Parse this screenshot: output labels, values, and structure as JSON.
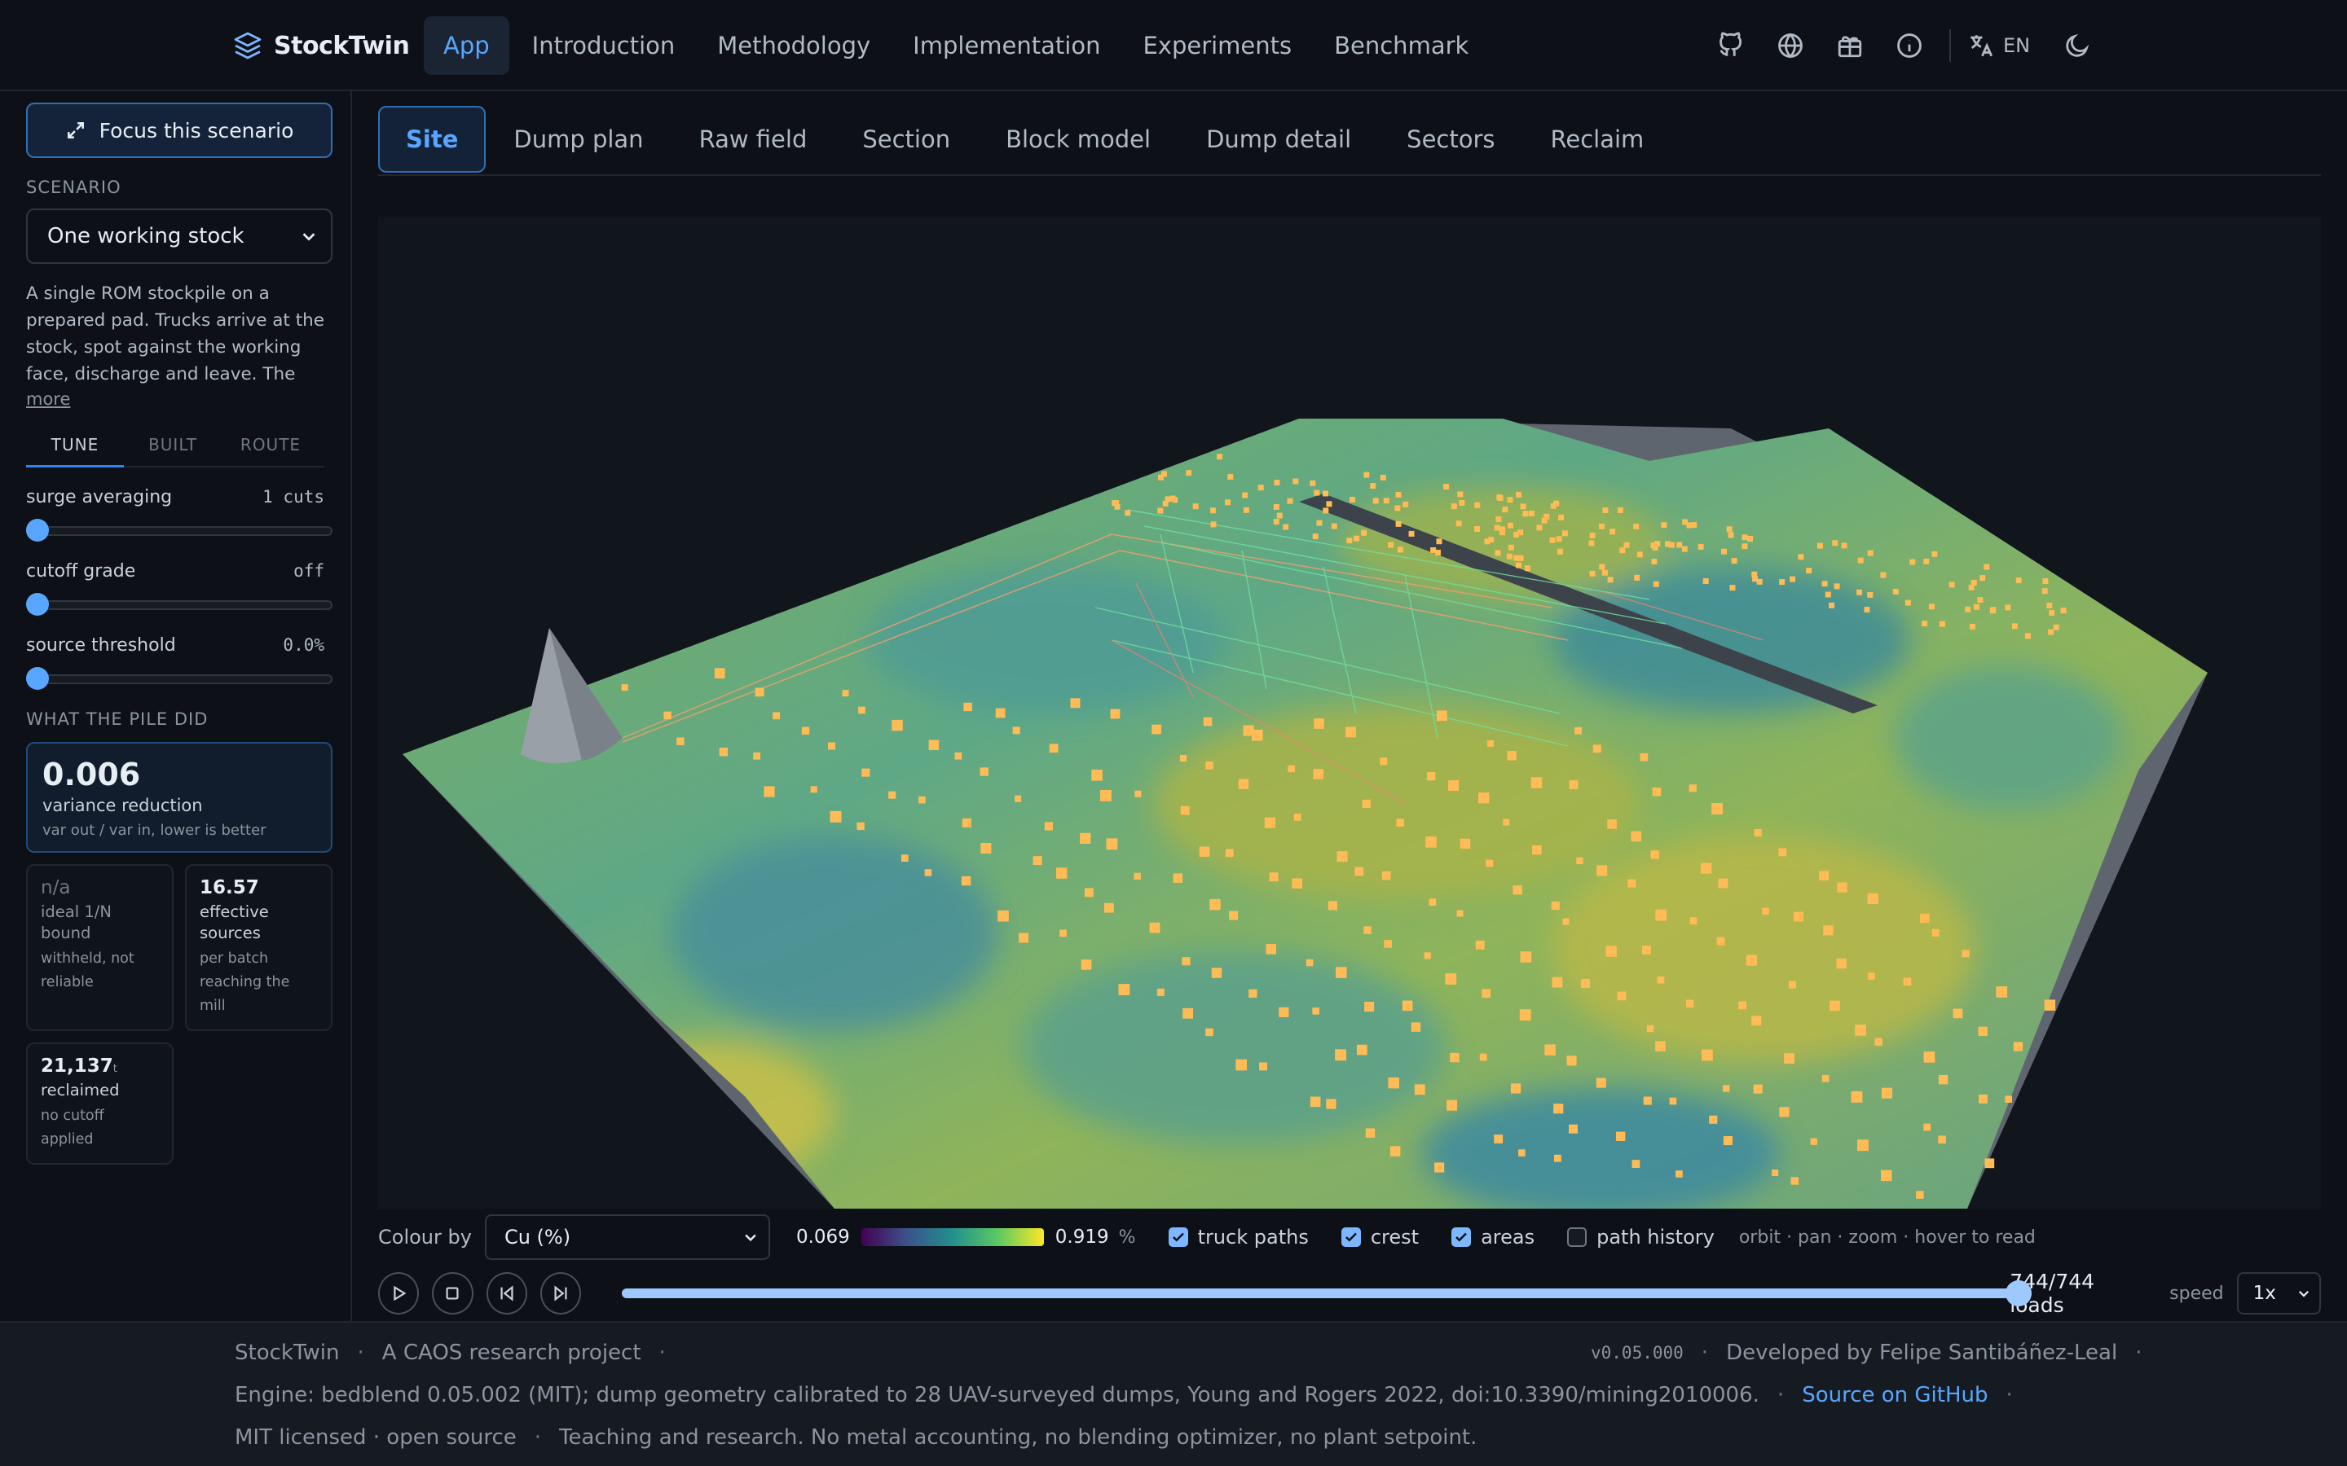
{
  "app": {
    "name": "StockTwin"
  },
  "nav": {
    "links": [
      "App",
      "Introduction",
      "Methodology",
      "Implementation",
      "Experiments",
      "Benchmark"
    ],
    "active": "App",
    "icons": [
      "github-icon",
      "globe-icon",
      "gift-icon",
      "info-icon",
      "translate-icon",
      "moon-icon"
    ],
    "lang": "EN"
  },
  "sidebar": {
    "focus_label": "Focus this scenario",
    "scenario_label": "SCENARIO",
    "scenario_value": "One working stock",
    "description": "A single ROM stockpile on a prepared pad. Trucks arrive at the stock, spot against the working face, discharge and leave. The haul from the pit is o...",
    "more": "more",
    "sub_tabs": [
      "TUNE",
      "BUILT",
      "ROUTE"
    ],
    "controls": [
      {
        "label": "surge averaging",
        "value": "1 cuts",
        "level": 0
      },
      {
        "label": "cutoff grade",
        "value": "off",
        "level": 0
      },
      {
        "label": "source threshold",
        "value": "0.0%",
        "level": 0
      }
    ],
    "results_label": "WHAT THE PILE DID",
    "primary": {
      "value": "0.006",
      "label": "variance reduction",
      "sub": "var out / var in, lower is better"
    },
    "cards": [
      {
        "value": "n/a",
        "unit": "",
        "label": "ideal 1/N bound",
        "sub": "withheld, not reliable"
      },
      {
        "value": "16.57",
        "unit": "",
        "label": "effective sources",
        "sub": "per batch reaching the mill"
      },
      {
        "value": "21,137",
        "unit": "t",
        "label": "reclaimed",
        "sub": "no cutoff applied"
      }
    ]
  },
  "tabs": [
    "Site",
    "Dump plan",
    "Raw field",
    "Section",
    "Block model",
    "Dump detail",
    "Sectors",
    "Reclaim"
  ],
  "active_tab": "Site",
  "legend": {
    "colour_by_label": "Colour by",
    "colour_by_value": "Cu (%)",
    "min": "0.069",
    "max": "0.919",
    "unit": "%",
    "toggles": [
      {
        "label": "truck paths",
        "checked": true
      },
      {
        "label": "crest",
        "checked": true
      },
      {
        "label": "areas",
        "checked": true
      },
      {
        "label": "path history",
        "checked": false
      }
    ],
    "hint": "orbit · pan · zoom · hover to read"
  },
  "player": {
    "progress": 1.0,
    "loads": "744/744 loads",
    "speed_label": "speed",
    "speed_value": "1x"
  },
  "footer": {
    "brand": "StockTwin",
    "project": "A CAOS research project",
    "version": "v0.05.000",
    "developer": "Developed by Felipe Santibáñez-Leal",
    "engine": "Engine: bedblend 0.05.002 (MIT); dump geometry calibrated to 28 UAV-surveyed dumps, Young and Rogers 2022, doi:10.3390/mining2010006.",
    "source": "Source on GitHub",
    "license": "MIT licensed · open source",
    "note": "Teaching and research. No metal accounting, no blending optimizer, no plant setpoint."
  },
  "colors": {
    "accent": "#58a6ff",
    "background": "#0d1117",
    "point": "#ffb84d"
  }
}
